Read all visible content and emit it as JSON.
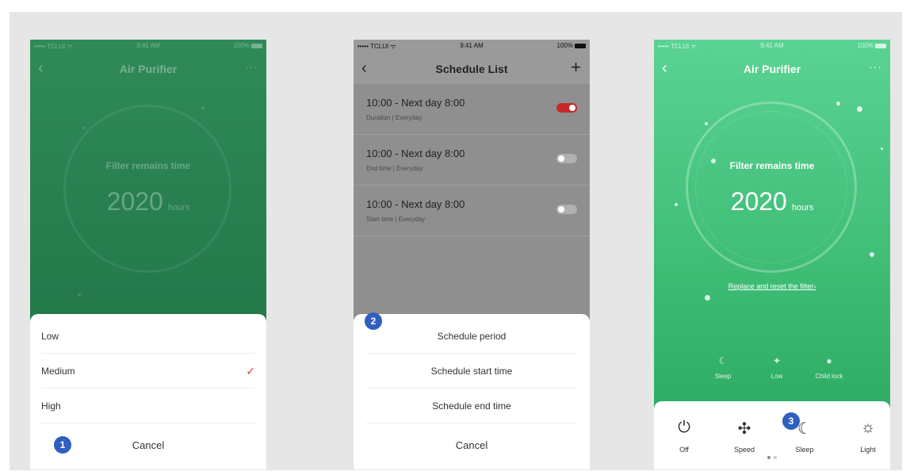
{
  "screen1": {
    "status": {
      "carrier": "••••• TCLUI ᯤ",
      "time": "9:41 AM",
      "battery": "100%"
    },
    "nav": {
      "back_icon": "‹",
      "title": "Air Purifier",
      "more_icon": "···"
    },
    "filter_label": "Filter remains time",
    "hours_value": "2020",
    "hours_unit": "hours",
    "sheet": {
      "options": [
        "Low",
        "Medium",
        "High"
      ],
      "selected": "Medium",
      "check_icon": "✓",
      "cancel": "Cancel",
      "badge": "1"
    }
  },
  "screen2": {
    "status": {
      "carrier": "••••• TCLUI ᯤ",
      "time": "9:41 AM",
      "battery": "100%"
    },
    "nav": {
      "back_icon": "‹",
      "title": "Schedule List",
      "add_icon": "+"
    },
    "schedules": [
      {
        "time": "10:00 - Next day 8:00",
        "sub": "Duration | Everyday",
        "on": true
      },
      {
        "time": "10:00 - Next day 8:00",
        "sub": "End time | Everyday",
        "on": false
      },
      {
        "time": "10:00 - Next day 8:00",
        "sub": "Start time | Everyday",
        "on": false
      }
    ],
    "sheet": {
      "options": [
        "Schedule period",
        "Schedule start time",
        "Schedule end time"
      ],
      "cancel": "Cancel",
      "badge": "2"
    }
  },
  "screen3": {
    "status": {
      "carrier": "••••• TCLUI ᯤ",
      "time": "9:41 AM",
      "battery": "100%"
    },
    "nav": {
      "back_icon": "‹",
      "title": "Air Purifier",
      "more_icon": "···"
    },
    "filter_label": "Filter remains time",
    "hours_value": "2020",
    "hours_unit": "hours",
    "replace_link": "Replace and reset the filter›",
    "quick_status": [
      {
        "icon": "moon-icon",
        "label": "Sleep"
      },
      {
        "icon": "fan-low-icon",
        "label": "Low"
      },
      {
        "icon": "child-lock-icon",
        "label": "Child lock"
      }
    ],
    "controls": [
      {
        "icon": "power-icon",
        "label": "Off"
      },
      {
        "icon": "fan-icon",
        "label": "Speed"
      },
      {
        "icon": "moon-icon",
        "label": "Sleep"
      },
      {
        "icon": "lightbulb-icon",
        "label": "Light"
      }
    ],
    "badge": "3",
    "colors": {
      "gradient_top": "#5ad394",
      "gradient_bottom": "#27a55f"
    }
  }
}
